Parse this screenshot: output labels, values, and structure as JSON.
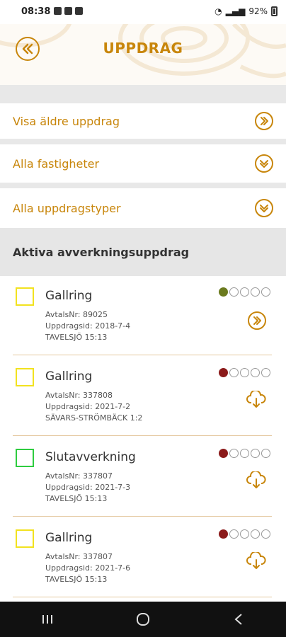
{
  "status": {
    "time": "08:38",
    "battery": "92%"
  },
  "header": {
    "title": "UPPDRAG"
  },
  "filters": [
    {
      "label": "Visa äldre uppdrag",
      "icon": "double-chevron-right-icon"
    },
    {
      "label": "Alla fastigheter",
      "icon": "double-chevron-down-icon"
    },
    {
      "label": "Alla uppdragstyper",
      "icon": "double-chevron-down-icon"
    }
  ],
  "section": {
    "title": "Aktiva avverkningsuppdrag"
  },
  "assignments": [
    {
      "type": "Gallring",
      "avtal": "AvtalsNr: 89025",
      "uppdragstid": "Uppdragsid: 2018-7-4",
      "place": "TAVELSJÖ 15:13",
      "status_color": "#6b7a1e",
      "checkbox_color": "yellow",
      "action": "double-chevron-right-icon"
    },
    {
      "type": "Gallring",
      "avtal": "AvtalsNr: 337808",
      "uppdragstid": "Uppdragsid: 2021-7-2",
      "place": "SÄVARS-STRÖMBÄCK 1:2",
      "status_color": "#8b1a1a",
      "checkbox_color": "yellow",
      "action": "cloud-download-icon"
    },
    {
      "type": "Slutavverkning",
      "avtal": "AvtalsNr: 337807",
      "uppdragstid": "Uppdragsid: 2021-7-3",
      "place": "TAVELSJÖ 15:13",
      "status_color": "#8b1a1a",
      "checkbox_color": "green",
      "action": "cloud-download-icon"
    },
    {
      "type": "Gallring",
      "avtal": "AvtalsNr: 337807",
      "uppdragstid": "Uppdragsid: 2021-7-6",
      "place": "TAVELSJÖ 15:13",
      "status_color": "#8b1a1a",
      "checkbox_color": "yellow",
      "action": "cloud-download-icon"
    }
  ],
  "colors": {
    "accent": "#c8860b",
    "checkbox_yellow": "#f2e21f",
    "checkbox_green": "#2ecc40"
  }
}
